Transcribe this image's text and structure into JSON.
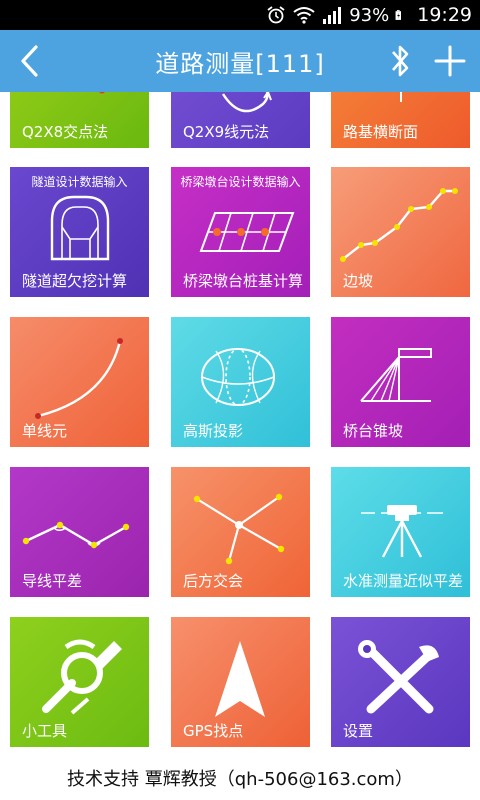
{
  "status_bar": {
    "battery": "93%",
    "time": "19:29"
  },
  "app_bar": {
    "title": "道路测量[111]"
  },
  "tiles": {
    "q2x8": {
      "label": "Q2X8交点法"
    },
    "q2x9": {
      "label": "Q2X9线元法"
    },
    "roadbed": {
      "label": "路基横断面"
    },
    "tunnel": {
      "top": "隧道设计数据输入",
      "label": "隧道超欠挖计算"
    },
    "bridge_pile": {
      "top": "桥梁墩台设计数据输入",
      "label": "桥梁墩台桩基计算"
    },
    "slope": {
      "label": "边坡"
    },
    "single_element": {
      "label": "单线元"
    },
    "gauss": {
      "label": "高斯投影"
    },
    "abutment_cone": {
      "label": "桥台锥坡"
    },
    "traverse": {
      "label": "导线平差"
    },
    "resection": {
      "label": "后方交会"
    },
    "leveling": {
      "label": "水准测量近似平差"
    },
    "tools": {
      "label": "小工具"
    },
    "gps": {
      "label": "GPS找点"
    },
    "settings": {
      "label": "设置"
    }
  },
  "footer": {
    "text": "技术支持 覃辉教授（qh-506@163.com）"
  }
}
